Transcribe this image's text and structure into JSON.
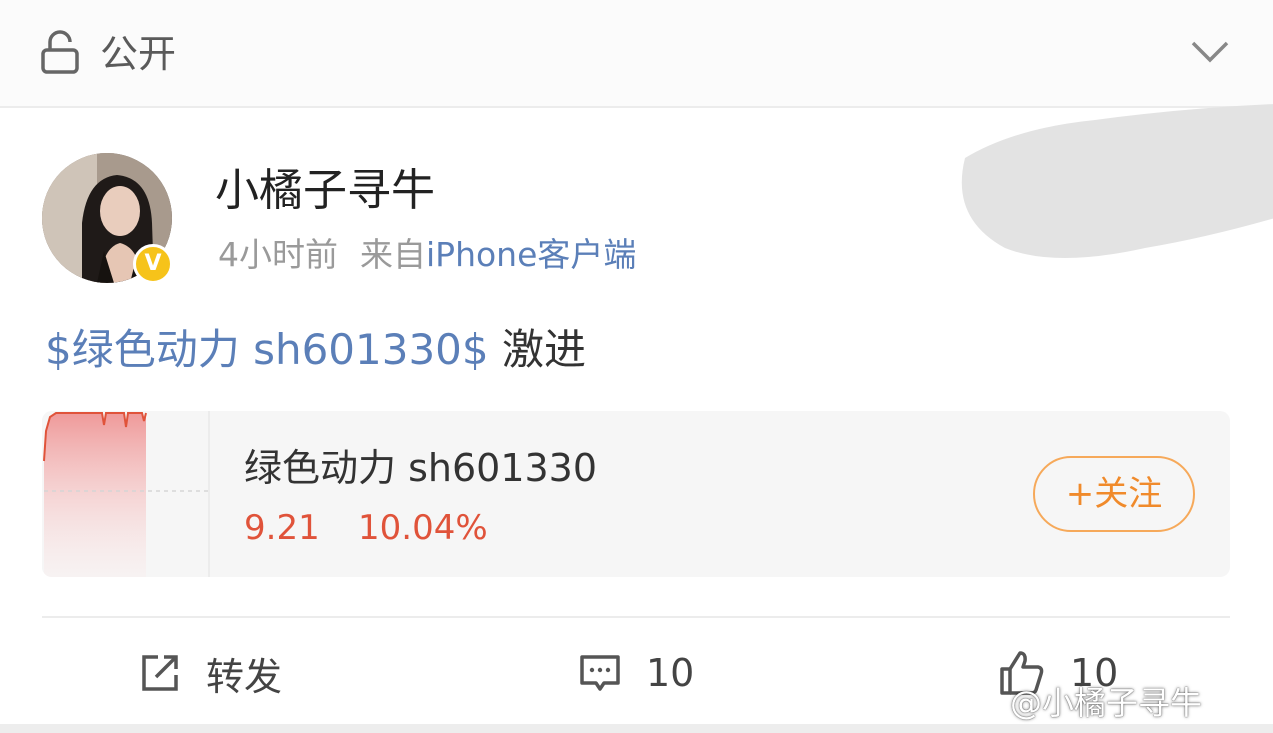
{
  "header": {
    "visibility_label": "公开",
    "icons": {
      "lock": "lock-open-icon",
      "chevron": "chevron-down-icon"
    }
  },
  "post": {
    "author": "小橘子寻牛",
    "time": "4小时前",
    "source_prefix": "来自",
    "source": "iPhone客户端",
    "stock_tag": "$绿色动力 sh601330$",
    "text_suffix": " 激进",
    "verified_badge": "V"
  },
  "stock_card": {
    "name": "绿色动力 sh601330",
    "price": "9.21",
    "change": "10.04%",
    "follow_label": "+关注",
    "colors": {
      "price": "#e0533a",
      "follow": "#f08a2b"
    }
  },
  "actions": {
    "repost_label": "转发",
    "comment_count": "10",
    "like_count": "10"
  },
  "watermark": "@小橘子寻牛",
  "colors": {
    "link": "#5b7fb8",
    "badge": "#f6c31a"
  }
}
